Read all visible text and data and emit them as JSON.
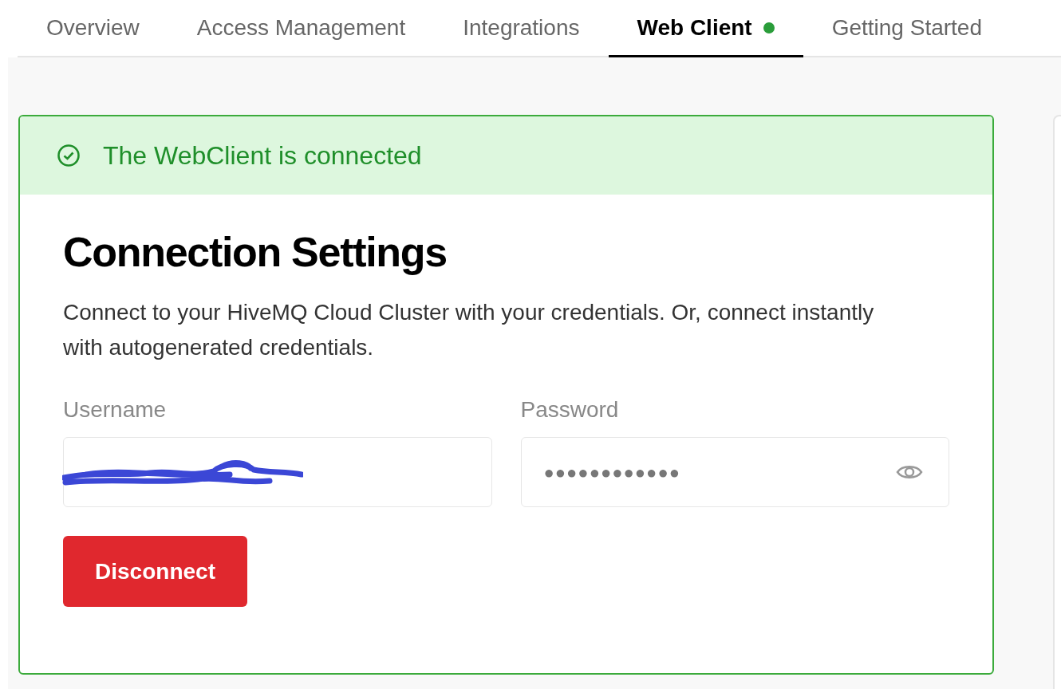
{
  "tabs": [
    {
      "label": "Overview",
      "selected": false,
      "status_dot": false
    },
    {
      "label": "Access Management",
      "selected": false,
      "status_dot": false
    },
    {
      "label": "Integrations",
      "selected": false,
      "status_dot": false
    },
    {
      "label": "Web Client",
      "selected": true,
      "status_dot": true
    },
    {
      "label": "Getting Started",
      "selected": false,
      "status_dot": false
    }
  ],
  "alert": {
    "kind": "success",
    "text": "The WebClient is connected"
  },
  "settings": {
    "title": "Connection Settings",
    "description": "Connect to your HiveMQ Cloud Cluster with your credentials. Or, connect instantly with autogenerated credentials.",
    "username": {
      "label": "Username",
      "redacted": true
    },
    "password": {
      "label": "Password",
      "value": "●●●●●●●●●●●●"
    },
    "button": "Disconnect"
  }
}
